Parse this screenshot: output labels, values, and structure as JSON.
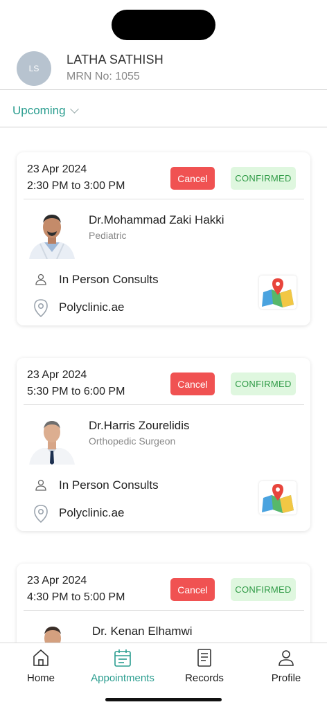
{
  "user": {
    "initials": "LS",
    "name": "LATHA SATHISH",
    "mrn": "MRN No: 1055"
  },
  "filter": {
    "label": "Upcoming"
  },
  "appointments": [
    {
      "date": "23 Apr 2024",
      "time": "2:30 PM to 3:00 PM",
      "cancel_label": "Cancel",
      "status": "CONFIRMED",
      "doctor": "Dr.Mohammad Zaki Hakki",
      "specialty": "Pediatric",
      "consult_type": "In Person Consults",
      "location": "Polyclinic.ae"
    },
    {
      "date": "23 Apr 2024",
      "time": "5:30 PM to 6:00 PM",
      "cancel_label": "Cancel",
      "status": "CONFIRMED",
      "doctor": "Dr.Harris Zourelidis",
      "specialty": "Orthopedic Surgeon",
      "consult_type": "In Person Consults",
      "location": "Polyclinic.ae"
    },
    {
      "date": "23 Apr 2024",
      "time": "4:30 PM to 5:00 PM",
      "cancel_label": "Cancel",
      "status": "CONFIRMED",
      "doctor": "Dr. Kenan Elhamwi",
      "specialty": "",
      "consult_type": "",
      "location": ""
    }
  ],
  "nav": [
    {
      "label": "Home",
      "icon": "home-icon"
    },
    {
      "label": "Appointments",
      "icon": "calendar-icon"
    },
    {
      "label": "Records",
      "icon": "records-icon"
    },
    {
      "label": "Profile",
      "icon": "profile-icon"
    }
  ],
  "colors": {
    "accent": "#2a9d8f",
    "cancel": "#f05252",
    "confirmed_bg": "#dff7df",
    "confirmed_text": "#2e9a45"
  }
}
